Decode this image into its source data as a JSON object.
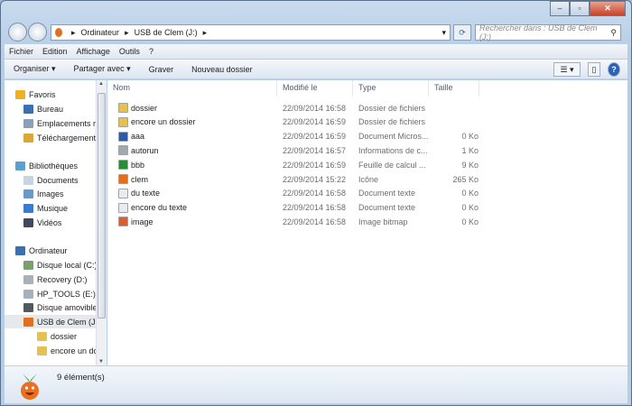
{
  "window": {
    "controls": [
      "minimize",
      "maximize",
      "close"
    ]
  },
  "address": {
    "breadcrumb": [
      "Ordinateur",
      "USB de Clem (J:)"
    ],
    "search_placeholder": "Rechercher dans : USB de Clem (J:)"
  },
  "menu": [
    "Fichier",
    "Edition",
    "Affichage",
    "Outils",
    "?"
  ],
  "toolbar": {
    "organize": "Organiser ▾",
    "share": "Partager avec ▾",
    "burn": "Graver",
    "new_folder": "Nouveau dossier"
  },
  "sidebar": [
    {
      "label": "Favoris",
      "icon": "star-icon",
      "color": "#f0b020",
      "indent": 0
    },
    {
      "label": "Bureau",
      "icon": "desktop-icon",
      "color": "#3a6fb0",
      "indent": 1
    },
    {
      "label": "Emplacements récents",
      "icon": "recent-places-icon",
      "color": "#8aa0b8",
      "indent": 1
    },
    {
      "label": "Téléchargements",
      "icon": "downloads-icon",
      "color": "#d8a838",
      "indent": 1
    },
    {
      "label": "Bibliothèques",
      "icon": "libraries-icon",
      "color": "#5aa0d0",
      "indent": 0
    },
    {
      "label": "Documents",
      "icon": "documents-icon",
      "color": "#c8d4e0",
      "indent": 1
    },
    {
      "label": "Images",
      "icon": "images-icon",
      "color": "#6a9ac8",
      "indent": 1
    },
    {
      "label": "Musique",
      "icon": "music-icon",
      "color": "#3a7ad0",
      "indent": 1
    },
    {
      "label": "Vidéos",
      "icon": "videos-icon",
      "color": "#404a58",
      "indent": 1
    },
    {
      "label": "Ordinateur",
      "icon": "computer-icon",
      "color": "#3a6fb0",
      "indent": 0
    },
    {
      "label": "Disque local (C:)",
      "icon": "drive-icon",
      "color": "#7aa070",
      "indent": 1
    },
    {
      "label": "Recovery (D:)",
      "icon": "drive-icon",
      "color": "#a8b0b8",
      "indent": 1
    },
    {
      "label": "HP_TOOLS (E:)",
      "icon": "drive-icon",
      "color": "#a8b0b8",
      "indent": 1
    },
    {
      "label": "Disque amovible",
      "icon": "removable-drive-icon",
      "color": "#505860",
      "indent": 1
    },
    {
      "label": "USB de Clem (J:)",
      "icon": "usb-onion-icon",
      "color": "#e07020",
      "indent": 1,
      "selected": true
    },
    {
      "label": "dossier",
      "icon": "folder-icon",
      "color": "#e8c050",
      "indent": 2
    },
    {
      "label": "encore un dossier",
      "icon": "folder-icon",
      "color": "#e8c050",
      "indent": 2
    }
  ],
  "columns": [
    "Nom",
    "Modifié le",
    "Type",
    "Taille"
  ],
  "files": [
    {
      "name": "dossier",
      "date": "22/09/2014 16:58",
      "type": "Dossier de fichiers",
      "size": "",
      "icon": "folder-icon",
      "color": "#e8c050"
    },
    {
      "name": "encore un dossier",
      "date": "22/09/2014 16:59",
      "type": "Dossier de fichiers",
      "size": "",
      "icon": "folder-icon",
      "color": "#e8c050"
    },
    {
      "name": "aaa",
      "date": "22/09/2014 16:59",
      "type": "Document Micros...",
      "size": "0 Ko",
      "icon": "word-doc-icon",
      "color": "#2a5aa8"
    },
    {
      "name": "autorun",
      "date": "22/09/2014 16:57",
      "type": "Informations de c...",
      "size": "1 Ko",
      "icon": "settings-file-icon",
      "color": "#a0a8b0"
    },
    {
      "name": "bbb",
      "date": "22/09/2014 16:59",
      "type": "Feuille de calcul ...",
      "size": "9 Ko",
      "icon": "excel-sheet-icon",
      "color": "#2a8a3a"
    },
    {
      "name": "clem",
      "date": "22/09/2014 15:22",
      "type": "Icône",
      "size": "265 Ko",
      "icon": "onion-icon",
      "color": "#e07020"
    },
    {
      "name": "du texte",
      "date": "22/09/2014 16:58",
      "type": "Document texte",
      "size": "0 Ko",
      "icon": "text-file-icon",
      "color": "#e8ecf0"
    },
    {
      "name": "encore du texte",
      "date": "22/09/2014 16:58",
      "type": "Document texte",
      "size": "0 Ko",
      "icon": "text-file-icon",
      "color": "#e8ecf0"
    },
    {
      "name": "image",
      "date": "22/09/2014 16:58",
      "type": "Image bitmap",
      "size": "0 Ko",
      "icon": "bitmap-icon",
      "color": "#d86030"
    }
  ],
  "status": {
    "count": "9 élément(s)"
  }
}
